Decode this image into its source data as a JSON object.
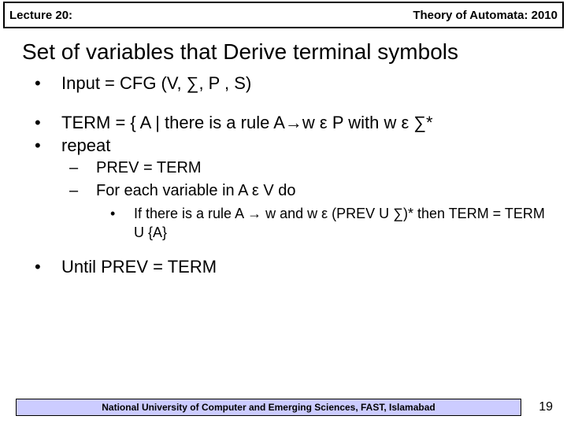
{
  "header": {
    "left": "Lecture 20:",
    "right": "Theory of Automata: 2010"
  },
  "title": "Set of variables that Derive terminal symbols",
  "bullets": {
    "b1": "Input = CFG (V, ∑, P , S)",
    "b2": "TERM = { A | there is a rule A→w ε P with w ε ∑*",
    "b3": "repeat",
    "s1": "PREV = TERM",
    "s2": "For each variable in A ε V do",
    "ss1": "If there is a rule A → w and w ε  (PREV U ∑)* then TERM = TERM U {A}",
    "b4": "Until PREV = TERM"
  },
  "footer": "National University of Computer and Emerging Sciences, FAST, Islamabad",
  "page": "19"
}
